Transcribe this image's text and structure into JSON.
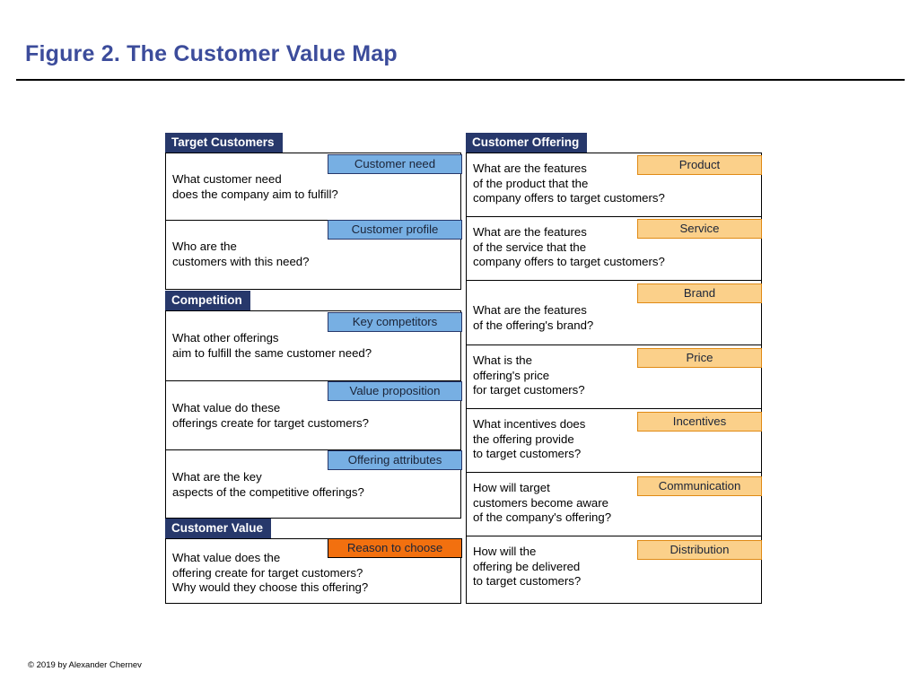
{
  "page": {
    "title": "Figure 2. The Customer Value Map",
    "footer_credit": "© 2019 by Alexander Chernev",
    "accent_title_color": "#3C4C9B",
    "header_bar_color": "#27386B",
    "blue_badge_color": "#77AFE3",
    "orange_badge_color": "#FBD08A",
    "highlight_badge_color": "#F2700F"
  },
  "left_column": {
    "groups": [
      {
        "header": "Target Customers",
        "rows": [
          {
            "badge": "Customer need",
            "badge_style": "blue",
            "text": "What customer need\ndoes the company aim to fulfill?"
          },
          {
            "badge": "Customer profile",
            "badge_style": "blue",
            "text": "Who are the\ncustomers with this need?"
          }
        ]
      },
      {
        "header": "Competition",
        "rows": [
          {
            "badge": "Key competitors",
            "badge_style": "blue",
            "text": "What other offerings\naim to fulfill the same customer need?"
          },
          {
            "badge": "Value proposition",
            "badge_style": "blue",
            "text": "What value do these\nofferings create for target customers?"
          },
          {
            "badge": "Offering attributes",
            "badge_style": "blue",
            "text": "What are the key\naspects of the competitive offerings?"
          }
        ]
      },
      {
        "header": "Customer Value",
        "rows": [
          {
            "badge": "Reason to choose",
            "badge_style": "solid-orange",
            "text": "What value does the\noffering create for target customers?\nWhy would they choose this offering?"
          }
        ]
      }
    ]
  },
  "right_column": {
    "groups": [
      {
        "header": "Customer Offering",
        "rows": [
          {
            "badge": "Product",
            "badge_style": "orange",
            "text": "What are the features\nof the product that the\ncompany offers to target customers?"
          },
          {
            "badge": "Service",
            "badge_style": "orange",
            "text": "What are the features\nof the service that the\ncompany offers to target customers?"
          },
          {
            "badge": "Brand",
            "badge_style": "orange",
            "text": "What are the features\nof the offering's brand?"
          },
          {
            "badge": "Price",
            "badge_style": "orange",
            "text": "What is the\noffering's price\nfor target customers?"
          },
          {
            "badge": "Incentives",
            "badge_style": "orange",
            "text": "What incentives does\nthe offering provide\nto target customers?"
          },
          {
            "badge": "Communication",
            "badge_style": "orange",
            "text": "How will target\ncustomers become aware\nof the company's offering?"
          },
          {
            "badge": "Distribution",
            "badge_style": "orange",
            "text": "How will the\noffering be delivered\nto target customers?"
          }
        ]
      }
    ]
  }
}
